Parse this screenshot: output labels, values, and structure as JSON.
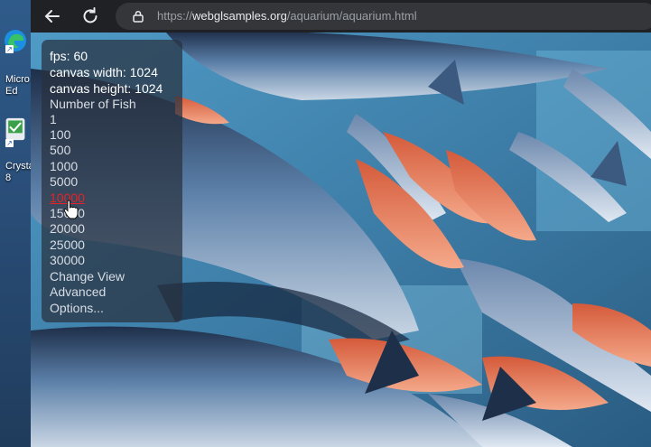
{
  "browser": {
    "url_prefix": "https://",
    "url_domain": "webglsamples.org",
    "url_path": "/aquarium/aquarium.html"
  },
  "desktop": {
    "icons": [
      {
        "label": "Micro",
        "label2": "Ed"
      },
      {
        "label": "Crystal",
        "label2": "8"
      }
    ]
  },
  "stats": {
    "fps": "fps: 60",
    "canvas_width": "canvas width: 1024",
    "canvas_height": "canvas height: 1024"
  },
  "menu": {
    "fish_header": "Number of Fish",
    "fish_options": [
      "1",
      "100",
      "500",
      "1000",
      "5000",
      "10000",
      "15000",
      "20000",
      "25000",
      "30000"
    ],
    "selected_fish": "10000",
    "change_view": "Change View",
    "advanced": "Advanced",
    "options": "Options..."
  },
  "colors": {
    "selected": "#e0242a",
    "overlay_bg": "rgba(40,48,62,0.72)",
    "water": "#3d7ea8"
  }
}
